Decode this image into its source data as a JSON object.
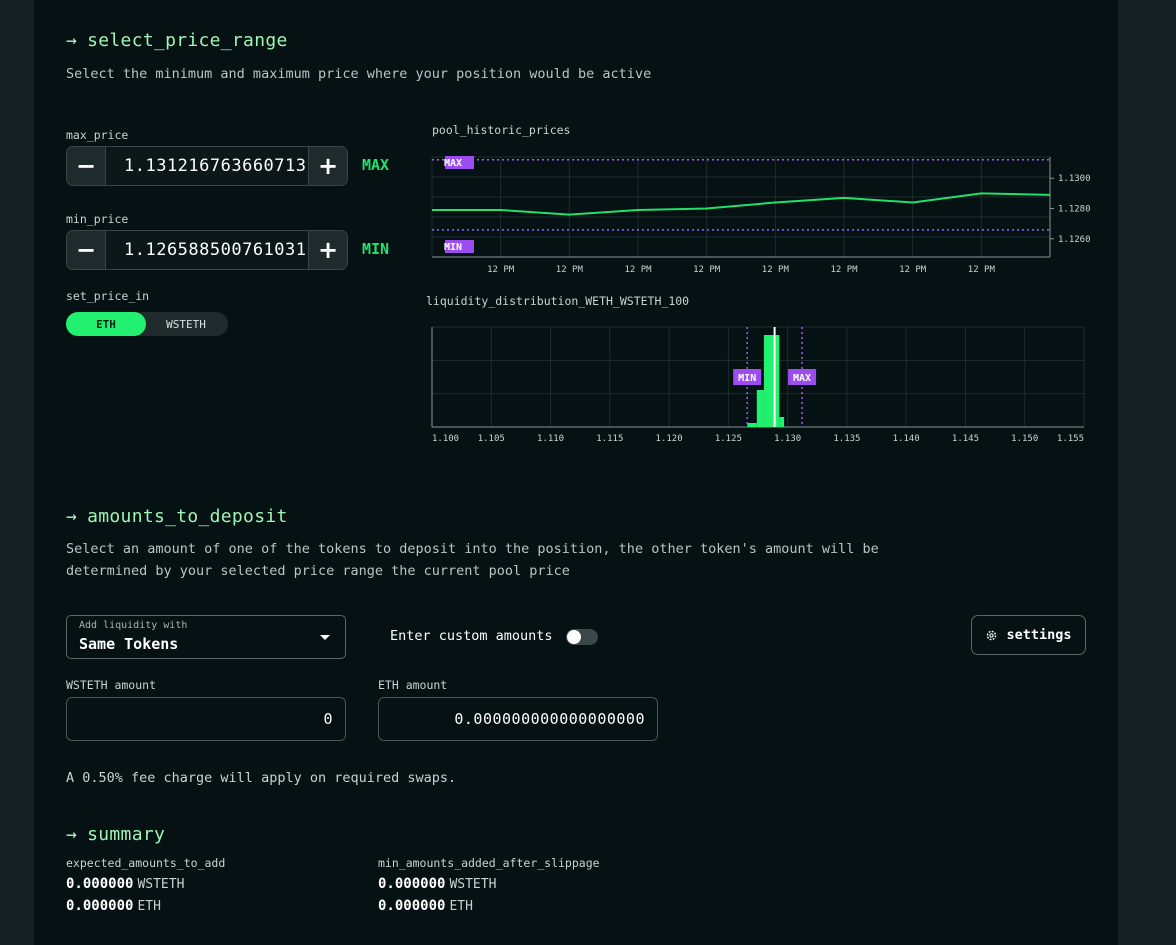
{
  "price_range": {
    "heading": "select_price_range",
    "description": "Select the minimum and maximum price where your position would be active",
    "max_label": "max_price",
    "max_value": "1.131216763660713",
    "max_tag": "MAX",
    "min_label": "min_price",
    "min_value": "1.126588500761031",
    "min_tag": "MIN",
    "minus_symbol": "−",
    "plus_symbol": "+",
    "set_price_label": "set_price_in",
    "toggle_options": [
      "ETH",
      "WSTETH"
    ],
    "toggle_selected": "ETH"
  },
  "historic_chart": {
    "title": "pool_historic_prices",
    "max_marker": "MAX",
    "min_marker": "MIN"
  },
  "liquidity_chart": {
    "title": "liquidity_distribution_WETH_WSTETH_100",
    "min_marker": "MIN",
    "max_marker": "MAX"
  },
  "chart_data": [
    {
      "type": "line",
      "title": "pool_historic_prices",
      "x": [
        "12 PM",
        "12 PM",
        "12 PM",
        "12 PM",
        "12 PM",
        "12 PM",
        "12 PM",
        "12 PM"
      ],
      "series": [
        {
          "values": [
            1.1279,
            1.1279,
            1.1276,
            1.1279,
            1.128,
            1.1284,
            1.1287,
            1.1284,
            1.129,
            1.1289
          ]
        }
      ],
      "ylim": [
        1.1248,
        1.1314
      ],
      "yticks": [
        1.126,
        1.128,
        1.13
      ],
      "ytick_labels": [
        "1.1260",
        "1.1280",
        "1.1300"
      ],
      "max_price": 1.131216763660713,
      "min_price": 1.126588500761031,
      "grid": true
    },
    {
      "type": "bar",
      "title": "liquidity_distribution_WETH_WSTETH_100",
      "xlim": [
        1.1,
        1.155
      ],
      "xticks": [
        1.1,
        1.105,
        1.11,
        1.115,
        1.12,
        1.125,
        1.13,
        1.135,
        1.14,
        1.145,
        1.15,
        1.155
      ],
      "xtick_labels": [
        "1.100",
        "1.105",
        "1.110",
        "1.115",
        "1.120",
        "1.125",
        "1.130",
        "1.135",
        "1.140",
        "1.145",
        "1.150",
        "1.155"
      ],
      "bars": [
        {
          "x0": 1.1266,
          "x1": 1.1274,
          "value": 0.04
        },
        {
          "x0": 1.1274,
          "x1": 1.128,
          "value": 0.37
        },
        {
          "x0": 1.128,
          "x1": 1.1293,
          "value": 0.92
        },
        {
          "x0": 1.1293,
          "x1": 1.1297,
          "value": 0.1
        }
      ],
      "current_price": 1.1289,
      "max_price": 1.131216763660713,
      "min_price": 1.126588500761031,
      "grid": true
    }
  ],
  "deposit": {
    "heading": "amounts_to_deposit",
    "description": "Select an amount of one of the tokens to deposit into the position, the other token's amount will be determined by your selected price range the current pool price",
    "select_small_label": "Add liquidity with",
    "select_value": "Same Tokens",
    "custom_label": "Enter custom amounts",
    "settings_label": "settings",
    "wsteth_label": "WSTETH amount",
    "wsteth_value": "0",
    "eth_label": "ETH amount",
    "eth_value": "0.000000000000000000",
    "fee_note": "A 0.50% fee charge will apply on required swaps."
  },
  "summary": {
    "heading": "summary",
    "expected_label": "expected_amounts_to_add",
    "expected": [
      {
        "amount": "0.000000",
        "token": "WSTETH"
      },
      {
        "amount": "0.000000",
        "token": "ETH"
      }
    ],
    "min_label": "min_amounts_added_after_slippage",
    "min": [
      {
        "amount": "0.000000",
        "token": "WSTETH"
      },
      {
        "amount": "0.000000",
        "token": "ETH"
      }
    ]
  },
  "colors": {
    "accent_green": "#22f06f",
    "marker_purple": "#9b4df0",
    "heading_green": "#9ff5b3",
    "background": "#051113"
  }
}
